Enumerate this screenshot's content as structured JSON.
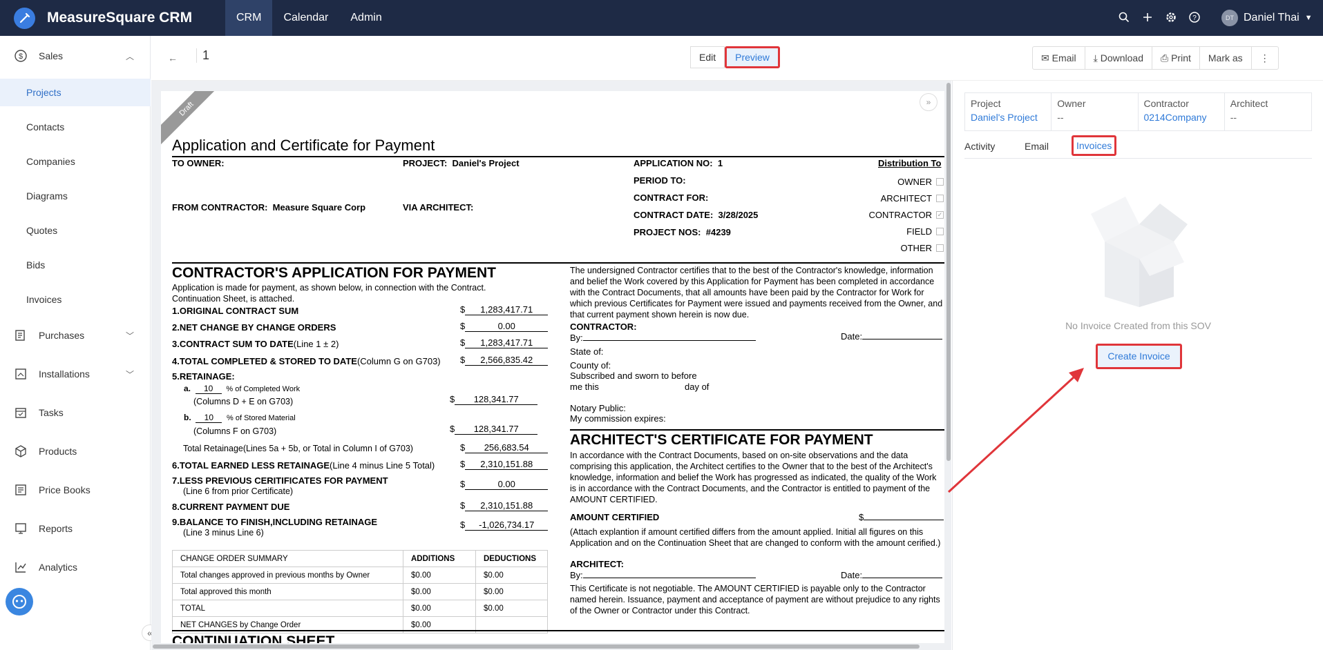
{
  "app": {
    "brand": "MeasureSquare CRM",
    "nav": [
      "CRM",
      "Calendar",
      "Admin"
    ],
    "user_initials": "DT",
    "user_name": "Daniel Thai"
  },
  "sidebar": {
    "groups": [
      {
        "label": "Sales",
        "icon": "dollar-icon",
        "expanded": true
      },
      {
        "label": "Purchases",
        "icon": "purchases-icon"
      },
      {
        "label": "Installations",
        "icon": "installations-icon"
      },
      {
        "label": "Tasks",
        "icon": "calendar-check-icon"
      },
      {
        "label": "Products",
        "icon": "box-icon"
      },
      {
        "label": "Price Books",
        "icon": "book-icon"
      },
      {
        "label": "Reports",
        "icon": "reports-icon"
      },
      {
        "label": "Analytics",
        "icon": "analytics-icon"
      }
    ],
    "sales_items": [
      "Projects",
      "Contacts",
      "Companies",
      "Diagrams",
      "Quotes",
      "Bids",
      "Invoices"
    ],
    "active_item": "Projects"
  },
  "header": {
    "doc_number": "1",
    "edit_label": "Edit",
    "preview_label": "Preview",
    "actions": [
      "Email",
      "Download",
      "Print",
      "Mark as"
    ]
  },
  "document": {
    "ribbon": "Draft",
    "title": "Application and Certificate for Payment",
    "to_owner_label": "TO OWNER:",
    "project_label": "PROJECT:",
    "project_value": "Daniel's Project",
    "from_contractor_label": "FROM CONTRACTOR:",
    "from_contractor_value": "Measure Square Corp",
    "via_architect_label": "VIA ARCHITECT:",
    "application_no_label": "APPLICATION NO:",
    "application_no_value": "1",
    "period_to_label": "PERIOD TO:",
    "contract_for_label": "CONTRACT FOR:",
    "contract_date_label": "CONTRACT DATE:",
    "contract_date_value": "3/28/2025",
    "project_nos_label": "PROJECT NOS:",
    "project_nos_value": "#4239",
    "distribution_label": "Distribution To",
    "distribution": [
      {
        "label": "OWNER",
        "checked": false
      },
      {
        "label": "ARCHITECT",
        "checked": false
      },
      {
        "label": "CONTRACTOR",
        "checked": true
      },
      {
        "label": "FIELD",
        "checked": false
      },
      {
        "label": "OTHER",
        "checked": false
      }
    ],
    "app_title": "CONTRACTOR'S APPLICATION FOR PAYMENT",
    "app_intro": "Application is made for payment, as shown below, in connection with the Contract. Continuation Sheet, is attached.",
    "lines": {
      "l1": "1.ORIGINAL CONTRACT SUM",
      "v1": "1,283,417.71",
      "l2": "2.NET CHANGE BY CHANGE ORDERS",
      "v2": "0.00",
      "l3a": "3.CONTRACT SUM TO DATE",
      "l3b": "(Line 1 ± 2)",
      "v3": "1,283,417.71",
      "l4a": "4.TOTAL COMPLETED & STORED TO DATE",
      "l4b": "(Column G on G703)",
      "v4": "2,566,835.42",
      "l5": "5.RETAINAGE:",
      "l5a": "a.",
      "p5a": "10",
      "t5a": "% of Completed Work",
      "s5a": "(Columns D + E on G703)",
      "v5a": "128,341.77",
      "l5b": "b.",
      "p5b": "10",
      "t5b": "% of Stored Material",
      "s5b": "(Columns F on G703)",
      "v5b": "128,341.77",
      "lret": "Total Retainage(Lines 5a + 5b, or Total in Column I of G703)",
      "vret": "256,683.54",
      "l6a": "6.TOTAL EARNED LESS RETAINAGE",
      "l6b": "(Line 4 minus Line 5 Total)",
      "v6": "2,310,151.88",
      "l7a": "7.LESS PREVIOUS CERITIFICATES FOR PAYMENT",
      "l7b": "(Line 6 from prior Certificate)",
      "v7": "0.00",
      "l8": "8.CURRENT PAYMENT DUE",
      "v8": "2,310,151.88",
      "l9a": "9.BALANCE TO FINISH,INCLUDING RETAINAGE",
      "l9b": "(Line 3 minus Line 6)",
      "v9": "-1,026,734.17",
      "dollar": "$"
    },
    "co_summary": {
      "headers": [
        "CHANGE ORDER SUMMARY",
        "ADDITIONS",
        "DEDUCTIONS"
      ],
      "rows": [
        [
          "Total changes approved in previous months by Owner",
          "$0.00",
          "$0.00"
        ],
        [
          "Total approved this month",
          "$0.00",
          "$0.00"
        ],
        [
          "TOTAL",
          "$0.00",
          "$0.00"
        ],
        [
          "NET CHANGES by Change Order",
          "$0.00",
          ""
        ]
      ]
    },
    "continuation_title": "CONTINUATION SHEET",
    "certify_text": "The undersigned Contractor certifies that to the best of the Contractor's knowledge, information and belief the Work covered by this Application for Payment has been completed in accordance with the Contract Documents, that all amounts have been paid by the Contractor for Work for which previous Certificates for Payment were issued and payments received from the Owner, and that current payment shown herein is now due.",
    "contractor_label": "CONTRACTOR:",
    "by_label": "By:",
    "date_label": "Date:",
    "state_of": "State of:",
    "county_of": "County of:",
    "subscribed": "Subscribed and sworn to before",
    "me_this": "me this",
    "day_of": "day of",
    "notary": "Notary Public:",
    "commission": "My commission expires:",
    "arch_title": "ARCHITECT'S CERTIFICATE FOR PAYMENT",
    "arch_text": "In accordance with the Contract Documents, based on on-site observations and the data comprising this application, the Architect certifies to the Owner that to the best of the Architect's knowledge, information and belief the Work has progressed as indicated, the quality of the Work is in accordance with the Contract Documents, and the Contractor is entitled to payment of the AMOUNT CERTIFIED.",
    "amount_certified": "AMOUNT CERTIFIED",
    "attach_text": "(Attach explantion if amount certified differs from the amount applied. Initial all figures on this Application and on the Continuation Sheet that are changed to conform with the amount cerified.)",
    "architect_label": "ARCHITECT:",
    "final_text": "This Certificate is not negotiable. The AMOUNT CERTIFIED is payable only to the Contractor named herein. Issuance, payment and acceptance of payment are without prejudice to any rights of the Owner or Contractor under this Contract."
  },
  "right": {
    "info": [
      {
        "label": "Project",
        "value": "Daniel's Project"
      },
      {
        "label": "Owner",
        "value": "--"
      },
      {
        "label": "Contractor",
        "value": "0214Company"
      },
      {
        "label": "Architect",
        "value": "--"
      }
    ],
    "tabs": [
      "Activity",
      "Email",
      "Invoices"
    ],
    "selected_tab": "Invoices",
    "empty_text": "No Invoice Created from this SOV",
    "create_label": "Create Invoice"
  },
  "colors": {
    "highlight": "#e0353a",
    "accent": "#2f7ad8",
    "topbar": "#1e2a45"
  }
}
